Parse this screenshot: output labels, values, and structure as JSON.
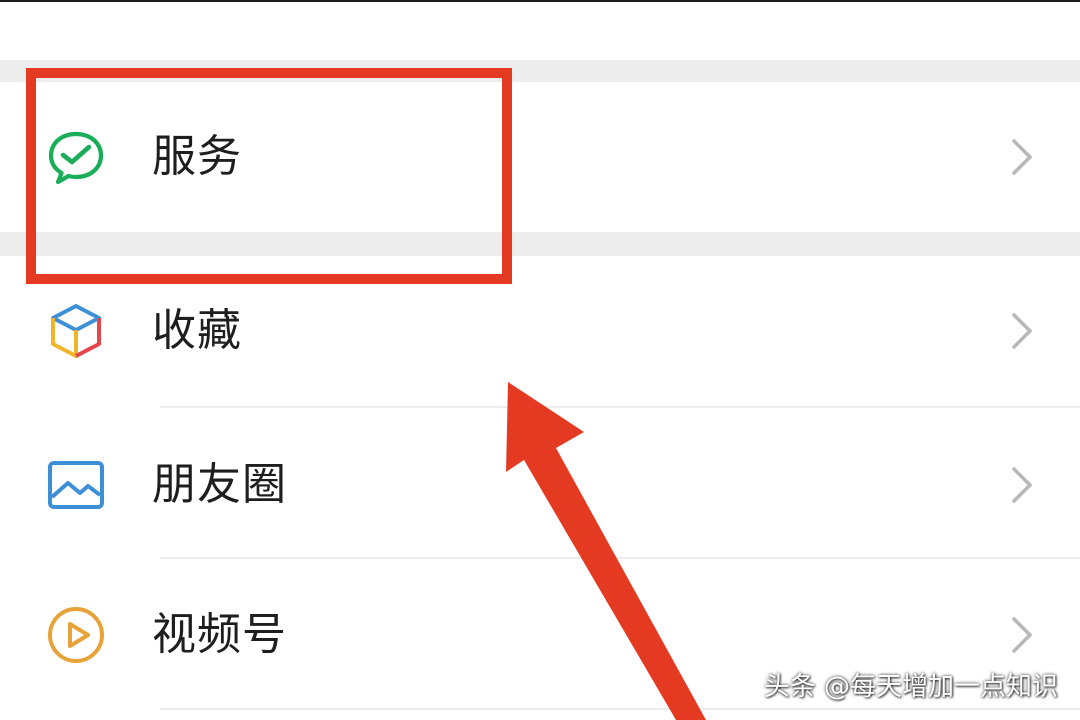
{
  "menu": {
    "items": [
      {
        "label": "服务",
        "icon": "wechat-pay-check-icon",
        "color": "#1aad5a"
      },
      {
        "label": "收藏",
        "icon": "favorites-cube-icon",
        "color": "#3d8fd8"
      },
      {
        "label": "朋友圈",
        "icon": "moments-picture-icon",
        "color": "#3d8fd8"
      },
      {
        "label": "视频号",
        "icon": "channels-play-icon",
        "color": "#e8a23a"
      }
    ]
  },
  "annotation": {
    "highlight_color": "#e53a22"
  },
  "watermark": {
    "text": "头条 @每天增加一点知识"
  }
}
